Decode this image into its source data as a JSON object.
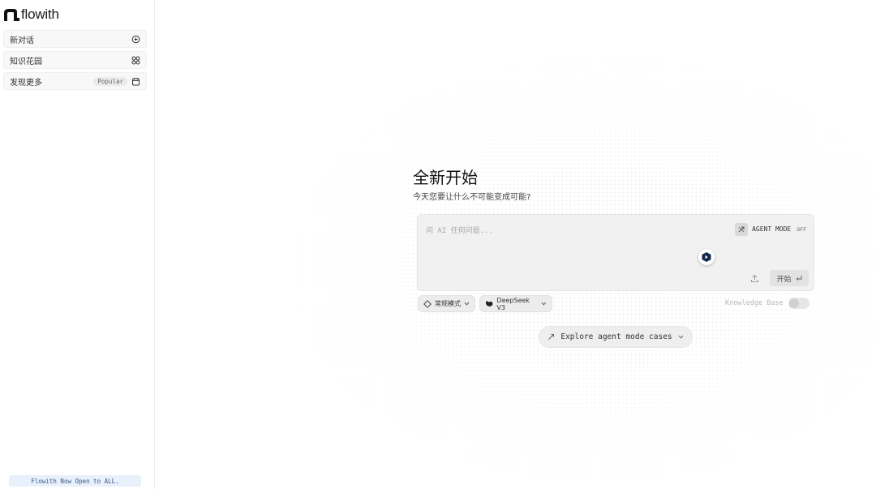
{
  "brand": {
    "name": "flowith"
  },
  "sidebar": {
    "items": [
      {
        "label": "新对话",
        "icon": "new-chat-icon"
      },
      {
        "label": "知识花园",
        "icon": "grid-icon"
      },
      {
        "label": "发现更多",
        "badge": "Popular",
        "icon": "calendar-icon"
      }
    ],
    "footer": "Flowith Now Open to ALL."
  },
  "hero": {
    "title": "全新开始",
    "subtitle": "今天您要让什么不可能变成可能?"
  },
  "composer": {
    "placeholder": "问 AI 任何问题...",
    "agent_label": "AGENT MODE",
    "agent_state": "OFF",
    "start_label": "开始"
  },
  "options": {
    "mode": "常规模式",
    "model": "DeepSeek V3",
    "knowledge_base": "Knowledge Base",
    "knowledge_base_enabled": false
  },
  "explore": {
    "label": "Explore agent mode cases"
  }
}
